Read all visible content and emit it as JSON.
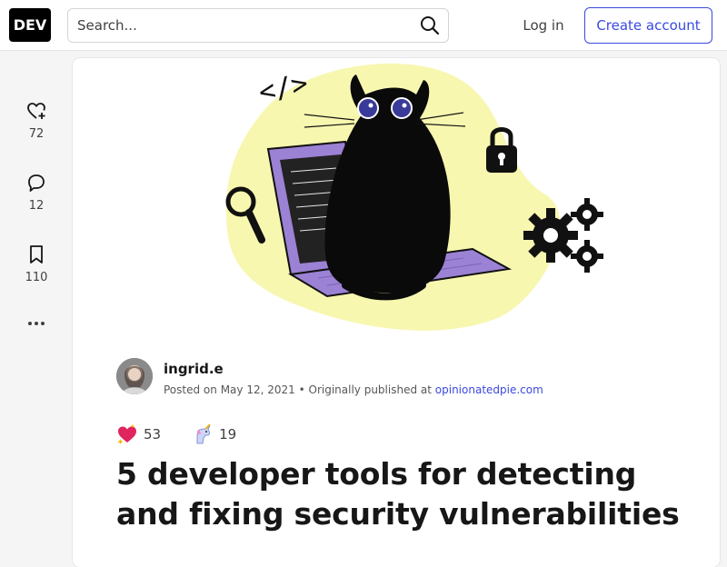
{
  "header": {
    "logo_text": "DEV",
    "search_placeholder": "Search...",
    "login_label": "Log in",
    "create_account_label": "Create account"
  },
  "sidebar": {
    "like_count": "72",
    "comment_count": "12",
    "bookmark_count": "110"
  },
  "article": {
    "cover_image": "illustration: black cat sitting on purple laptop with code bracket, magnifier, padlock and gears",
    "cover_code_glyph": "</>",
    "author_name": "ingrid.e",
    "posted_prefix": "Posted on",
    "posted_date": "May 12, 2021",
    "separator": "•",
    "origin_prefix": "Originally published at",
    "origin_site": "opinionatedpie.com",
    "reactions": [
      {
        "icon": "sparkle-heart-icon",
        "count": "53"
      },
      {
        "icon": "unicorn-icon",
        "count": "19"
      }
    ],
    "title": "5 developer tools for detecting and fixing security vulnerabilities"
  },
  "colors": {
    "accent": "#3b49df",
    "cover_blob": "#f7f7b0",
    "laptop": "#9b82d4"
  }
}
